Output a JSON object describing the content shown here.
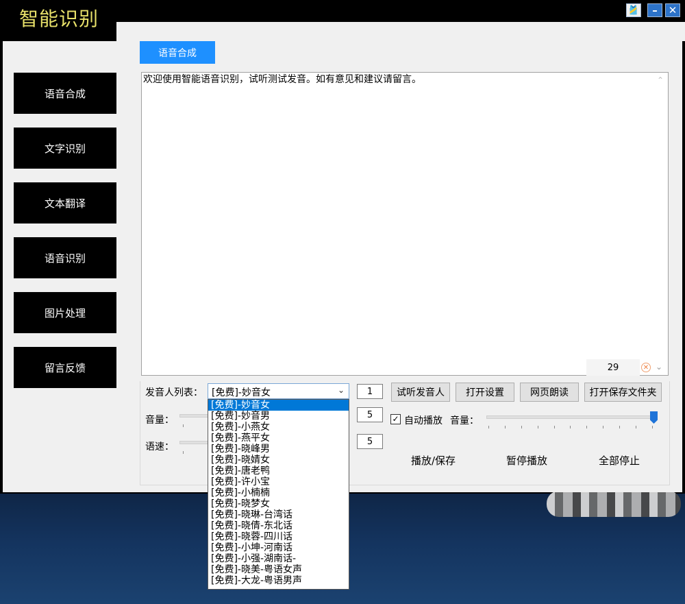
{
  "app": {
    "title": "智能识别"
  },
  "window_controls": {
    "skin": "🎽",
    "minimize": "–",
    "close": "✕"
  },
  "sidebar": {
    "items": [
      {
        "label": "语音合成"
      },
      {
        "label": "文字识别"
      },
      {
        "label": "文本翻译"
      },
      {
        "label": "语音识别"
      },
      {
        "label": "图片处理"
      },
      {
        "label": "留言反馈"
      }
    ]
  },
  "main": {
    "tab": "语音合成",
    "text": "欢迎使用智能语音识别，试听测试发音。如有意见和建议请留言。",
    "char_count": "29",
    "clear_icon": "✕",
    "scroll_up": "⌃",
    "scroll_down": "⌄"
  },
  "controls": {
    "speaker_label": "发音人列表：",
    "speaker_selected": "[免费]-妙音女",
    "combo_arrow": "⌄",
    "speaker_count": "1",
    "volume_label": "音量：",
    "volume_value": "5",
    "speed_label": "语速：",
    "speed_value": "5",
    "auto_play_checked": true,
    "auto_play_check": "✓",
    "auto_play_label": "自动播放",
    "volume2_label": "音量：",
    "volume2_level": 1.0,
    "buttons": {
      "preview": "试听发音人",
      "settings": "打开设置",
      "web_read": "网页朗读",
      "open_folder": "打开保存文件夹"
    },
    "actions": {
      "play_save": "播放/保存",
      "pause": "暂停播放",
      "stop_all": "全部停止"
    }
  },
  "dropdown": {
    "items": [
      "[免费]-妙音女",
      "[免费]-妙音男",
      "[免费]-小燕女",
      "[免费]-燕平女",
      "[免费]-晓峰男",
      "[免费]-晓婧女",
      "[免费]-唐老鸭",
      "[免费]-许小宝",
      "[免费]-小楠楠",
      "[免费]-晓梦女",
      "[免费]-晓琳-台湾话",
      "[免费]-晓倩-东北话",
      "[免费]-晓蓉-四川话",
      "[免费]-小坤-河南话",
      "[免费]-小强-湖南话-",
      "[免费]-晓美-粤语女声",
      "[免费]-大龙-粤语男声"
    ],
    "selected_index": 0
  }
}
